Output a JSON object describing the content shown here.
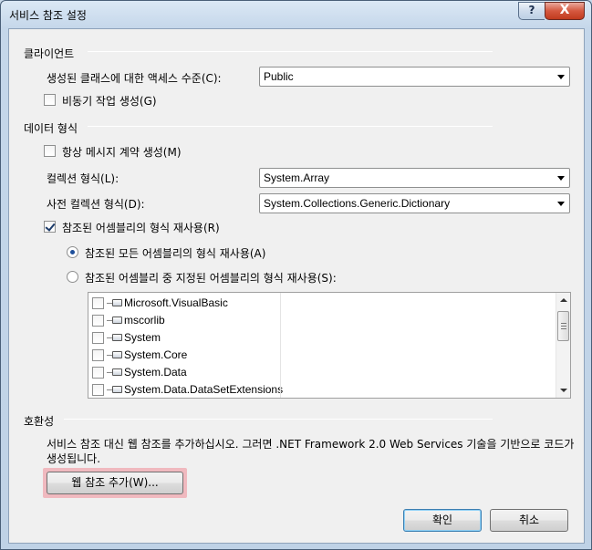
{
  "window": {
    "title": "서비스 참조 설정",
    "help_label": "?",
    "close_label": "X"
  },
  "client_section": {
    "heading": "클라이언트",
    "access_level_label": "생성된 클래스에 대한 액세스 수준(C):",
    "access_level_value": "Public",
    "async_label": "비동기 작업 생성(G)",
    "async_checked": false
  },
  "data_type_section": {
    "heading": "데이터 형식",
    "always_generate_label": "항상 메시지 계약 생성(M)",
    "always_generate_checked": false,
    "collection_type_label": "컬렉션 형식(L):",
    "collection_type_value": "System.Array",
    "dictionary_type_label": "사전 컬렉션 형식(D):",
    "dictionary_type_value": "System.Collections.Generic.Dictionary",
    "reuse_types_label": "참조된 어셈블리의 형식 재사용(R)",
    "reuse_types_checked": true,
    "reuse_all_label": "참조된 모든 어셈블리의 형식 재사용(A)",
    "reuse_all_selected": true,
    "reuse_specified_label": "참조된 어셈블리 중 지정된 어셈블리의 형식 재사용(S):",
    "reuse_specified_selected": false,
    "assemblies": [
      {
        "label": "Microsoft.VisualBasic",
        "checked": false
      },
      {
        "label": "mscorlib",
        "checked": false
      },
      {
        "label": "System",
        "checked": false
      },
      {
        "label": "System.Core",
        "checked": false
      },
      {
        "label": "System.Data",
        "checked": false
      },
      {
        "label": "System.Data.DataSetExtensions",
        "checked": false
      }
    ]
  },
  "compat_section": {
    "heading": "호환성",
    "description": "서비스 참조 대신 웹 참조를 추가하십시오. 그러면 .NET Framework 2.0 Web Services 기술을 기반으로 코드가 생성됩니다.",
    "add_web_ref_label": "웹 참조 추가(W)..."
  },
  "footer": {
    "ok_label": "확인",
    "cancel_label": "취소"
  },
  "colors": {
    "highlight": "#f0b9bf",
    "close_button": "#c03a1e",
    "default_button_border": "#3c7fb1"
  }
}
